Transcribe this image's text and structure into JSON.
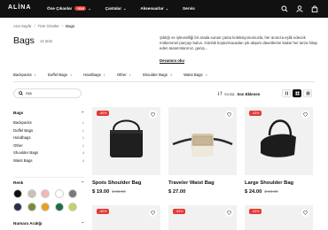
{
  "brand": "ALİNA",
  "nav": [
    {
      "label": "Öne Çıkanlar",
      "badge": "YENİ",
      "chevron": true
    },
    {
      "label": "Çantalar",
      "chevron": true
    },
    {
      "label": "Aksesuarlar",
      "chevron": true
    },
    {
      "label": "Servis",
      "chevron": false
    }
  ],
  "header_icons": [
    "search-icon",
    "user-icon",
    "bag-icon"
  ],
  "breadcrumb": [
    "Ana Sayfa",
    "Tüm Ürünler",
    "Bags"
  ],
  "page": {
    "title": "Bags",
    "count": "12 ürün",
    "description": "Şıklığı ve işlevselliği bir arada sunan çanta koleksiyonumuzla, her anınıza eşlik edecek mükemmel parçayı bulun. Günlük koşturmacadan şık akşam davetlerine kadar her tarza hitap eden tasarımlarımız, geniş...",
    "read_more": "Devamını oku"
  },
  "chips": [
    {
      "label": "Backpacks",
      "count": "1"
    },
    {
      "label": "Duffel Bags",
      "count": "1"
    },
    {
      "label": "Handbags",
      "count": "1"
    },
    {
      "label": "Other",
      "count": "1"
    },
    {
      "label": "Shoulder Bags",
      "count": "4"
    },
    {
      "label": "Waist Bags",
      "count": "4"
    }
  ],
  "search": {
    "value": "Ara"
  },
  "sort": {
    "label": "Sırala:",
    "value": "Son Eklenen"
  },
  "sidebar": {
    "heading": "Bags",
    "items": [
      {
        "label": "Backpacks",
        "count": "1"
      },
      {
        "label": "Duffel Bags",
        "count": "1"
      },
      {
        "label": "Handbags",
        "count": "1"
      },
      {
        "label": "Other",
        "count": "1"
      },
      {
        "label": "Shoulder Bags",
        "count": "4"
      },
      {
        "label": "Waist Bags",
        "count": "4"
      }
    ],
    "color_heading": "Renk",
    "colors": [
      "#111111",
      "#c9c2b6",
      "#f2b8b8",
      "#ffffff",
      "#7a7a7a",
      "#2b2f4a",
      "#7a8a3a",
      "#e8a21a",
      "#1f6b4a",
      "#c4d36a"
    ],
    "size_heading": "Numara Aralığı"
  },
  "products": [
    {
      "name": "Spots Shoulder Bag",
      "price": "$ 19.00",
      "old_price": "$ 38.00",
      "sale": "-50%"
    },
    {
      "name": "Traveler Waist Bag",
      "price": "$ 27.00",
      "old_price": "",
      "sale": ""
    },
    {
      "name": "Large Shoulder Bag",
      "price": "$ 24.00",
      "old_price": "$ 36.00",
      "sale": "-33%"
    }
  ],
  "second_row_badges": [
    "-50%",
    "-54%",
    "-33%"
  ]
}
